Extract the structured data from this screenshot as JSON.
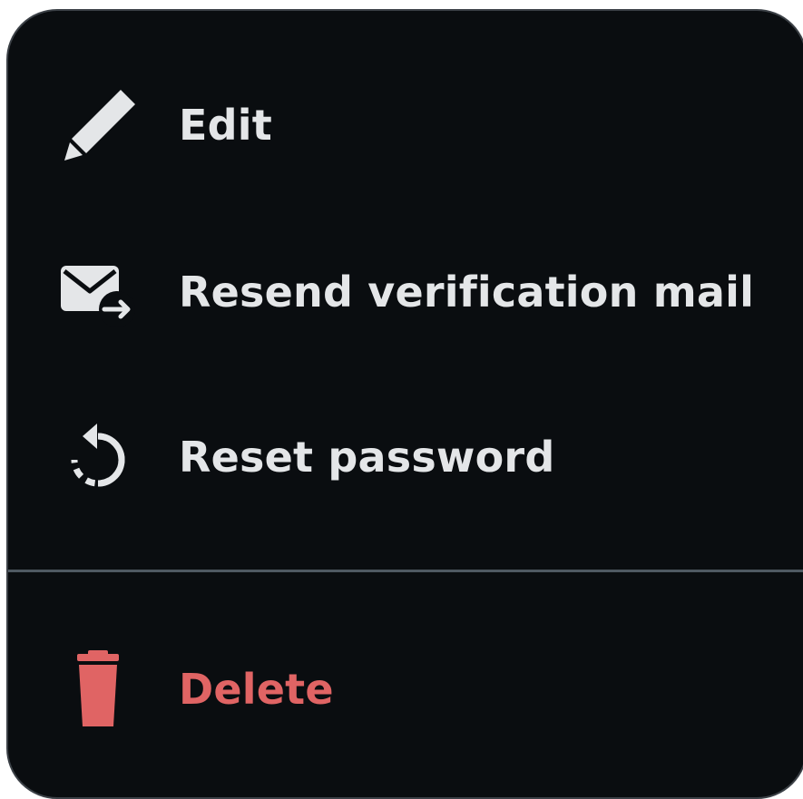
{
  "menu": {
    "items": [
      {
        "id": "edit",
        "label": "Edit",
        "icon": "pencil-icon"
      },
      {
        "id": "resend",
        "label": "Resend verification mail",
        "icon": "mail-forward-icon"
      },
      {
        "id": "reset",
        "label": "Reset password",
        "icon": "reset-icon"
      }
    ],
    "danger_item": {
      "id": "delete",
      "label": "Delete",
      "icon": "trash-icon"
    }
  },
  "colors": {
    "background": "#0a0d10",
    "border": "#3b4046",
    "text": "#e4e6e8",
    "danger": "#e06464",
    "divider": "#4f5962"
  }
}
